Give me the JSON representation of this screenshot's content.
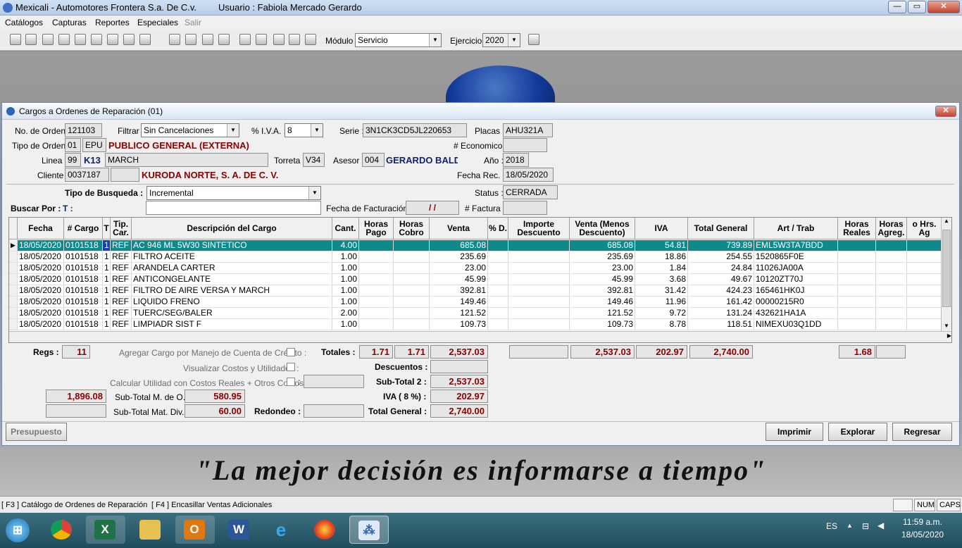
{
  "window": {
    "title": "Mexicali - Automotores Frontera S.a. De  C.v.",
    "user": "Usuario : Fabiola Mercado Gerardo"
  },
  "menu": [
    "Catálogos",
    "Capturas",
    "Reportes",
    "Especiales",
    "Salir"
  ],
  "toolbar": {
    "modulo_label": "Módulo :",
    "modulo_value": "Servicio",
    "ejercicio_label": "Ejercicio :",
    "ejercicio_value": "2020"
  },
  "slogan": "\"La mejor decisión es informarse a tiempo\"",
  "dialog": {
    "title": "Cargos a Ordenes de Reparación  (01)",
    "no_orden_label": "No. de Orden :",
    "no_orden": "121103",
    "filtrar_label": "Filtrar :",
    "filtrar": "Sin Cancelaciones",
    "iva_label": "% I.V.A. :",
    "iva": "8",
    "serie_label": "Serie :",
    "serie": "3N1CK3CD5JL220653",
    "placas_label": "Placas :",
    "placas": "AHU321A",
    "tipo_orden_label": "Tipo de Orden :",
    "tipo_orden_code": "01",
    "tipo_orden_abbr": "EPU",
    "tipo_orden_name": "PUBLICO GENERAL (EXTERNA)",
    "economico_label": "# Economico :",
    "economico": "",
    "linea_label": "Linea :",
    "linea_code": "99",
    "linea_abbr": "K13",
    "linea_name": "MARCH",
    "torreta_label": "Torreta :",
    "torreta": "V34",
    "asesor_label": "Asesor :",
    "asesor_code": "004",
    "asesor_name": "GERARDO BALDE",
    "anio_label": "Año :",
    "anio": "2018",
    "cliente_label": "Cliente :",
    "cliente_code": "0037187",
    "cliente_name": "KURODA NORTE, S. A. DE C. V.",
    "fecha_rec_label": "Fecha Rec. :",
    "fecha_rec": "18/05/2020",
    "tipo_busqueda_label": "Tipo de Busqueda :",
    "tipo_busqueda": "Incremental",
    "status_label": "Status :",
    "status": "CERRADA",
    "buscar_label": "Buscar Por :",
    "buscar_key": "T :",
    "fecha_fact_label": "Fecha de Facturación :",
    "fecha_fact": "/ /",
    "factura_label": "# Factura :"
  },
  "grid": {
    "headers": [
      "Fecha",
      "# Cargo",
      "T",
      "Tip. Car.",
      "Descripción del Cargo",
      "Cant.",
      "Horas Pago",
      "Horas Cobro",
      "Venta",
      "% D.",
      "Importe Descuento",
      "Venta (Menos Descuento)",
      "IVA",
      "Total General",
      "Art / Trab",
      "Horas Reales",
      "Horas Agreg.",
      "o Hrs. Ag"
    ],
    "rows": [
      [
        "18/05/2020",
        "0101518",
        "1",
        "REF",
        "AC 946 ML 5W30 SINTETICO",
        "4.00",
        "",
        "",
        "685.08",
        "",
        "",
        "685.08",
        "54.81",
        "739.89",
        "EML5W3TA7BDD",
        "",
        "",
        ""
      ],
      [
        "18/05/2020",
        "0101518",
        "1",
        "REF",
        "FILTRO ACEITE",
        "1.00",
        "",
        "",
        "235.69",
        "",
        "",
        "235.69",
        "18.86",
        "254.55",
        "1520865F0E",
        "",
        "",
        ""
      ],
      [
        "18/05/2020",
        "0101518",
        "1",
        "REF",
        "ARANDELA CARTER",
        "1.00",
        "",
        "",
        "23.00",
        "",
        "",
        "23.00",
        "1.84",
        "24.84",
        "11026JA00A",
        "",
        "",
        ""
      ],
      [
        "18/05/2020",
        "0101518",
        "1",
        "REF",
        "ANTICONGELANTE",
        "1.00",
        "",
        "",
        "45.99",
        "",
        "",
        "45.99",
        "3.68",
        "49.67",
        "10120ZT70J",
        "",
        "",
        ""
      ],
      [
        "18/05/2020",
        "0101518",
        "1",
        "REF",
        "FILTRO DE AIRE VERSA Y MARCH",
        "1.00",
        "",
        "",
        "392.81",
        "",
        "",
        "392.81",
        "31.42",
        "424.23",
        "165461HK0J",
        "",
        "",
        ""
      ],
      [
        "18/05/2020",
        "0101518",
        "1",
        "REF",
        "LIQUIDO FRENO",
        "1.00",
        "",
        "",
        "149.46",
        "",
        "",
        "149.46",
        "11.96",
        "161.42",
        "00000215R0",
        "",
        "",
        ""
      ],
      [
        "18/05/2020",
        "0101518",
        "1",
        "REF",
        "TUERC/SEG/BALER",
        "2.00",
        "",
        "",
        "121.52",
        "",
        "",
        "121.52",
        "9.72",
        "131.24",
        "432621HA1A",
        "",
        "",
        ""
      ],
      [
        "18/05/2020",
        "0101518",
        "1",
        "REF",
        "LIMPIADR SIST F",
        "1.00",
        "",
        "",
        "109.73",
        "",
        "",
        "109.73",
        "8.78",
        "118.51",
        "NIMEXU03Q1DD",
        "",
        "",
        ""
      ]
    ]
  },
  "totals": {
    "regs_label": "Regs :",
    "regs": "11",
    "agregar_label": "Agregar Cargo por Manejo de Cuenta de Crédito :",
    "totales_label": "Totales :",
    "horas_pago": "1.71",
    "horas_cobro": "1.71",
    "venta": "2,537.03",
    "venta_menos": "2,537.03",
    "iva": "202.97",
    "total": "2,740.00",
    "horas_reales": "1.68",
    "visualizar_label": "Visualizar Costos y Utilidades :",
    "descuentos_label": "Descuentos :",
    "descuentos": "",
    "calcular_label": "Calcular Utilidad con Costos Reales + Otros Costos :",
    "subtotal2_label": "Sub-Total 2 :",
    "subtotal2": "2,537.03",
    "left_amount": "1,896.08",
    "subtotal_mo_label": "Sub-Total M. de O. :",
    "subtotal_mo": "580.95",
    "iva_pct_label": "IVA ( 8 %) :",
    "iva_amount": "202.97",
    "subtotal_mat_label": "Sub-Total Mat. Div. :",
    "subtotal_mat": "60.00",
    "redondeo_label": "Redondeo :",
    "redondeo": "",
    "total_general_label": "Total General :",
    "total_general": "2,740.00"
  },
  "buttons": {
    "presupuesto": "Presupuesto",
    "imprimir": "Imprimir",
    "explorar": "Explorar",
    "regresar": "Regresar"
  },
  "statusbar": {
    "f3": "[ F3 ] Catálogo de Ordenes de Reparación",
    "f4": "[ F4 ] Encasillar Ventas Adicionales",
    "num": "NUM",
    "caps": "CAPS"
  },
  "taskbar": {
    "lang": "ES",
    "time": "11:59 a.m.",
    "date": "18/05/2020"
  }
}
